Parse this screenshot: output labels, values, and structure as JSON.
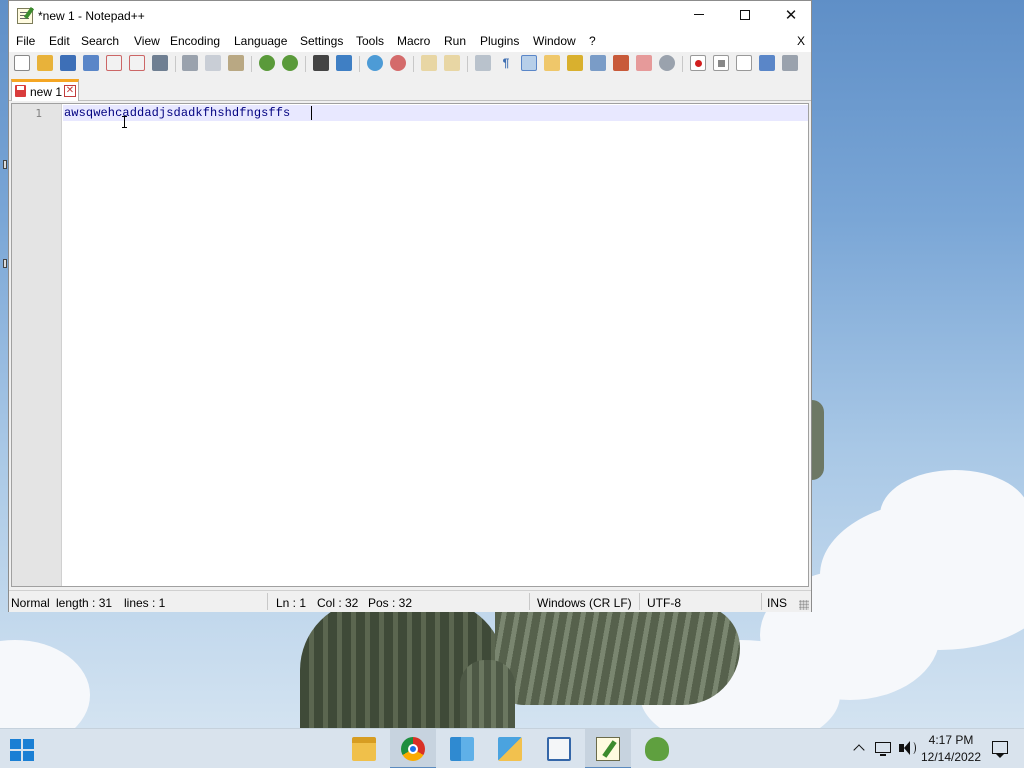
{
  "window": {
    "title": "*new 1 - Notepad++",
    "minimize_icon": "minimize-icon",
    "maximize_icon": "maximize-icon",
    "close_icon": "close-icon"
  },
  "menubar": {
    "items": [
      "File",
      "Edit",
      "Search",
      "View",
      "Encoding",
      "Language",
      "Settings",
      "Tools",
      "Macro",
      "Run",
      "Plugins",
      "Window",
      "?"
    ],
    "close_label": "X"
  },
  "toolbar": {
    "icons": [
      "new-file-icon",
      "open-file-icon",
      "save-icon",
      "save-all-icon",
      "close-icon",
      "close-all-icon",
      "print-icon",
      "cut-icon",
      "copy-icon",
      "paste-icon",
      "undo-icon",
      "redo-icon",
      "find-icon",
      "replace-icon",
      "zoom-in-icon",
      "zoom-out-icon",
      "sync-vertical-icon",
      "sync-horizontal-icon",
      "word-wrap-icon",
      "show-all-chars-icon",
      "indent-guide-icon",
      "user-language-icon",
      "doc-map-icon",
      "doc-list-icon",
      "function-list-icon",
      "folder-workspace-icon",
      "monitoring-icon",
      "record-macro-icon",
      "stop-macro-icon",
      "play-macro-icon",
      "run-macro-multiple-icon",
      "save-macro-icon"
    ]
  },
  "tabs": [
    {
      "label": "new 1",
      "modified": true,
      "close_icon": "tab-close-icon"
    }
  ],
  "editor": {
    "line_numbers": [
      "1"
    ],
    "lines": [
      "awsqwehcaddadjsdadkfhshdfngsffs"
    ]
  },
  "statusbar": {
    "mode": "Normal",
    "length": "length : 31",
    "lines": "lines : 1",
    "ln": "Ln : 1",
    "col": "Col : 32",
    "pos": "Pos : 32",
    "eol": "Windows (CR LF)",
    "encoding": "UTF-8",
    "insert_mode": "INS"
  },
  "taskbar": {
    "start_icon": "windows-start-icon",
    "apps": [
      "file-explorer-icon",
      "chrome-icon",
      "buildings-app-icon",
      "ruler-app-icon",
      "document-reader-icon",
      "notepadpp-icon",
      "frog-app-icon"
    ],
    "tray": {
      "chevron_icon": "show-hidden-icons-chevron",
      "network_icon": "network-icon",
      "volume_icon": "volume-icon",
      "notification_icon": "notification-icon",
      "time": "4:17 PM",
      "date": "12/14/2022"
    }
  },
  "colors": {
    "tab_accent": "#f5a623",
    "current_line": "#e8e8ff",
    "code_text": "#000080",
    "taskbar": "#d9e3ed"
  }
}
